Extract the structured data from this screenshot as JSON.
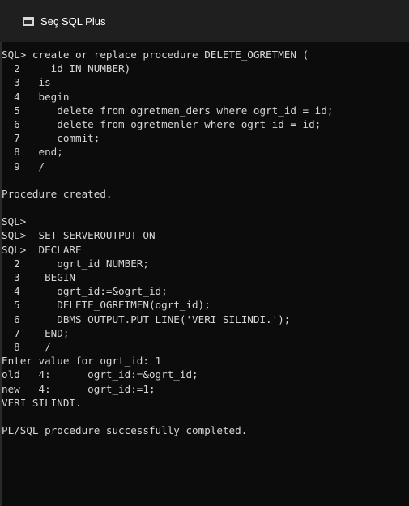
{
  "window": {
    "title": "Seç SQL Plus"
  },
  "colors": {
    "console_bg": "#0c0c0c",
    "console_text": "#d6d6d6",
    "titlebar_bg": "#1f1f1f"
  },
  "icons": {
    "app": "console-window-icon"
  },
  "console": {
    "lines": [
      "SQL> create or replace procedure DELETE_OGRETMEN (",
      "  2     id IN NUMBER)",
      "  3   is",
      "  4   begin",
      "  5      delete from ogretmen_ders where ogrt_id = id;",
      "  6      delete from ogretmenler where ogrt_id = id;",
      "  7      commit;",
      "  8   end;",
      "  9   /",
      "",
      "Procedure created.",
      "",
      "SQL>",
      "SQL>  SET SERVEROUTPUT ON",
      "SQL>  DECLARE",
      "  2      ogrt_id NUMBER;",
      "  3    BEGIN",
      "  4      ogrt_id:=&ogrt_id;",
      "  5      DELETE_OGRETMEN(ogrt_id);",
      "  6      DBMS_OUTPUT.PUT_LINE('VERI SILINDI.');",
      "  7    END;",
      "  8    /",
      "Enter value for ogrt_id: 1",
      "old   4:      ogrt_id:=&ogrt_id;",
      "new   4:      ogrt_id:=1;",
      "VERI SILINDI.",
      "",
      "PL/SQL procedure successfully completed."
    ]
  }
}
